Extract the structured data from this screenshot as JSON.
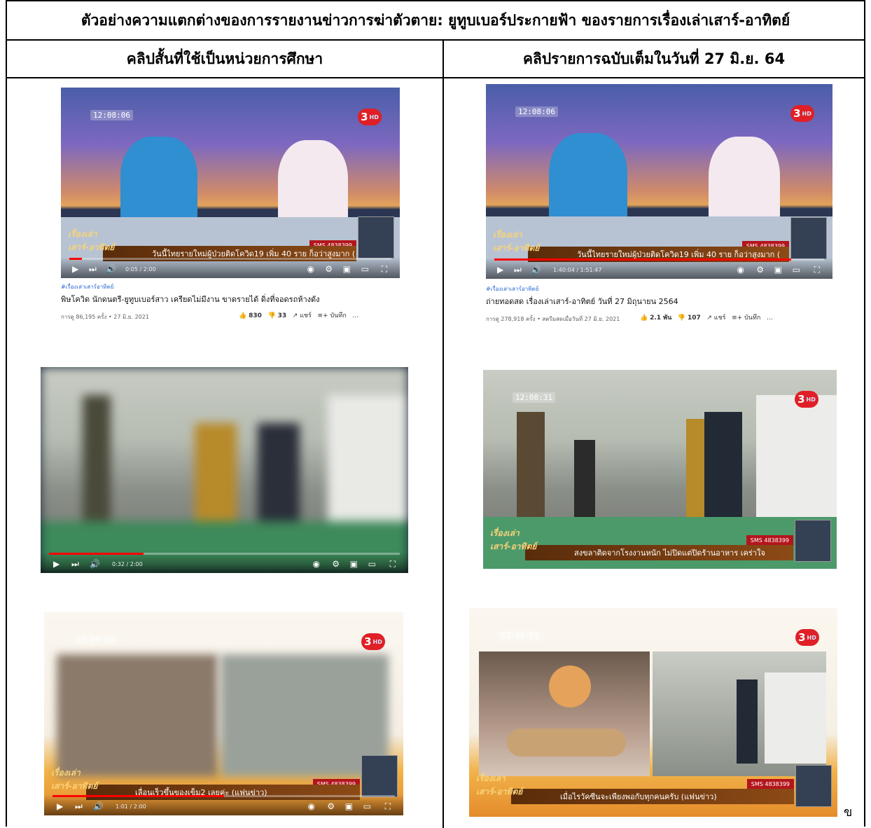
{
  "table": {
    "title": "ตัวอย่างความแตกต่างของการรายงานข่าวการฆ่าตัวตาย: ยูทูบเบอร์ประกายฟ้า ของรายการเรื่องเล่าเสาร์-อาทิตย์",
    "left_header": "คลิปสั้นที่ใช้เป็นหน่วยการศึกษา",
    "right_header": "คลิปรายการฉบับเต็มในวันที่ 27 มิ.ย. 64"
  },
  "overlay": {
    "sms": "SMS 4838399",
    "channel": "3",
    "channel_hd": "HD",
    "show_logo": "เรื่องเล่า เสาร์-อาทิตย์"
  },
  "left": {
    "v1": {
      "clock": "12:08:06",
      "ticker": "วันนี้ไทยรายใหม่ผู้ป่วยติดโควิด19 เพิ่ม 40 ราย ก็อว่าสูงมาก (",
      "time": "0:05 / 2:00",
      "progress": 0.04,
      "tag": "#เรื่องเล่าเสาร์อาทิตย์",
      "title": "พิษโควิด นักดนตรี-ยูทูบเบอร์สาว เครียดไม่มีงาน ขาดรายได้ ดิ่งที่จอดรถห้างดัง",
      "stats": "การดู 86,195 ครั้ง • 27 มิ.ย. 2021",
      "likes": "830",
      "dislikes": "33",
      "share": "แชร์",
      "save": "บันทึก"
    },
    "v2": {
      "time": "0:32 / 2:00",
      "progress": 0.27
    },
    "v3": {
      "clock": "12:09:03",
      "ticker": "เลื่อนเร็วขึ้นของเข็ม2 เลยค่ะ (แฟนข่าว)",
      "time": "1:01 / 2:00",
      "progress": 0.5
    }
  },
  "right": {
    "v1": {
      "clock": "12:08:06",
      "ticker": "วันนี้ไทยรายใหม่ผู้ป่วยติดโควิด19 เพิ่ม 40 ราย ก็อว่าสูงมาก (",
      "time": "1:40:04 / 1:51:47",
      "progress": 0.9,
      "tag": "#เรื่องเล่าเสาร์อาทิตย์",
      "title": "ถ่ายทอดสด เรื่องเล่าเสาร์-อาทิตย์ วันที่ 27 มิถุนายน 2564",
      "stats": "การดู 278,918 ครั้ง • สตรีมสดเมื่อวันที่ 27 มิ.ย. 2021",
      "likes": "2.1 พัน",
      "dislikes": "107",
      "share": "แชร์",
      "save": "บันทึก"
    },
    "v2": {
      "clock": "12:08:31",
      "ticker": "สงขลาติดจากโรงงานหนัก ไม่ปิดแต่ปิดร้านอาหาร เคร่าใจ"
    },
    "v3": {
      "clock": "12:09:14",
      "ticker": "เมื่อไรวัคซีนจะเพียงพอกับทุกคนครับ (แฟนข่าว)"
    }
  },
  "footnote_mark": "ข"
}
